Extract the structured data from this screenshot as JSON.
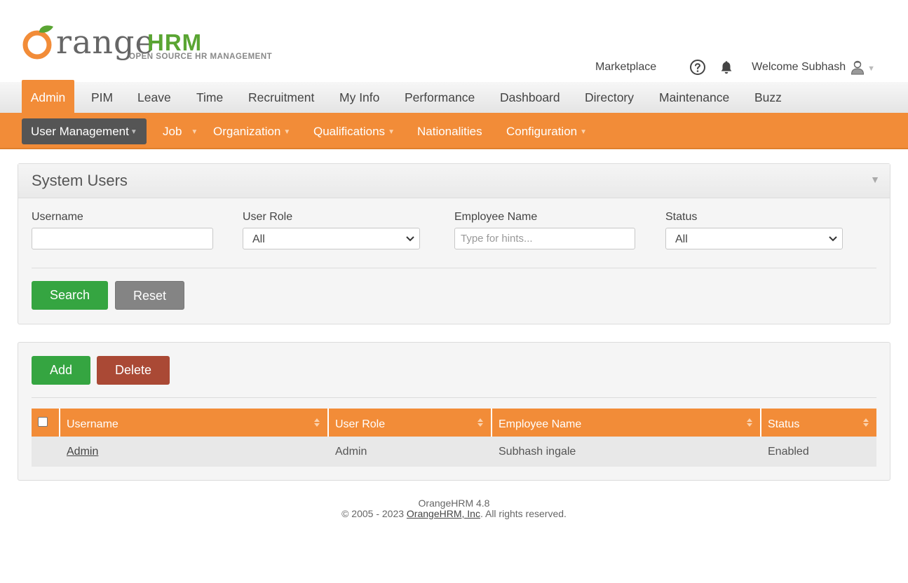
{
  "brand": {
    "logo_first_letter": "O",
    "logo_word": "range",
    "logo_hrm": "HRM",
    "logo_tagline": "OPEN SOURCE HR MANAGEMENT",
    "colors": {
      "orange": "#f28c38",
      "green": "#5aa533",
      "gray_text": "#666666"
    }
  },
  "topbar": {
    "marketplace": "Marketplace",
    "help_icon": "question-circle-icon",
    "notification_icon": "bell-icon",
    "welcome": "Welcome Subhash",
    "user_icon": "user-avatar-icon"
  },
  "mainmenu": {
    "items": [
      "Admin",
      "PIM",
      "Leave",
      "Time",
      "Recruitment",
      "My Info",
      "Performance",
      "Dashboard",
      "Directory",
      "Maintenance",
      "Buzz"
    ],
    "active": "Admin"
  },
  "submenu": {
    "items": [
      {
        "label": "User Management",
        "has_dropdown": true
      },
      {
        "label": "Job",
        "has_dropdown": true
      },
      {
        "label": "Organization",
        "has_dropdown": true
      },
      {
        "label": "Qualifications",
        "has_dropdown": true
      },
      {
        "label": "Nationalities",
        "has_dropdown": false
      },
      {
        "label": "Configuration",
        "has_dropdown": true
      }
    ],
    "active": "User Management"
  },
  "search_panel": {
    "title": "System Users",
    "username_label": "Username",
    "username_value": "",
    "user_role_label": "User Role",
    "user_role_value": "All",
    "employee_name_label": "Employee Name",
    "employee_name_placeholder": "Type for hints...",
    "status_label": "Status",
    "status_value": "All",
    "search_button": "Search",
    "reset_button": "Reset"
  },
  "list_panel": {
    "add_button": "Add",
    "delete_button": "Delete",
    "columns": [
      "Username",
      "User Role",
      "Employee Name",
      "Status"
    ],
    "rows": [
      {
        "username": "Admin",
        "user_role": "Admin",
        "employee_name": "Subhash ingale",
        "status": "Enabled"
      }
    ]
  },
  "footer": {
    "version": "OrangeHRM 4.8",
    "copyright_prefix": "© 2005 - 2023 ",
    "company_link": "OrangeHRM, Inc",
    "copyright_suffix": ". All rights reserved."
  }
}
